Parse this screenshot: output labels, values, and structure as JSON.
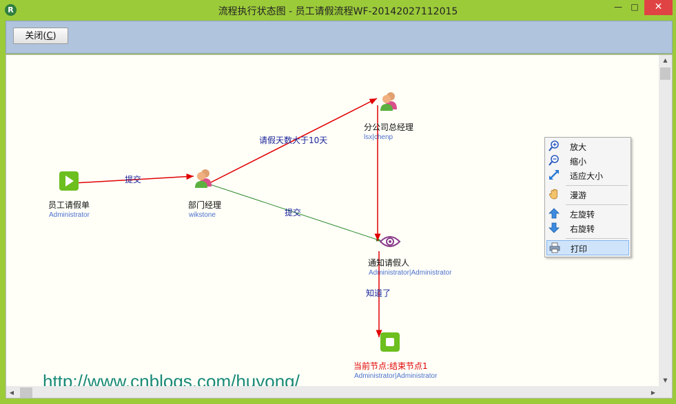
{
  "window": {
    "title": "流程执行状态图 - 员工请假流程WF-20142027112015",
    "app_icon": "R",
    "minimize_glyph": "—",
    "maximize_glyph": "□",
    "close_glyph": "✕"
  },
  "toolbar": {
    "close_label": "关闭(",
    "close_key": "C",
    "close_tail": ")"
  },
  "nodes": {
    "start": {
      "name": "员工请假单",
      "user": "Administrator"
    },
    "dept": {
      "name": "部门经理",
      "user": "wikstone"
    },
    "branch": {
      "name": "分公司总经理",
      "user": "lsx|chenp"
    },
    "notify": {
      "name": "通知请假人",
      "user": "Administrator|Administrator"
    },
    "end": {
      "name": "当前节点:结束节点1",
      "user": "Administrator|Administrator"
    }
  },
  "edges": {
    "submit1": "提交",
    "over10": "请假天数大于10天",
    "submit2": "提交",
    "acknowledged": "知道了"
  },
  "watermark": "http://www.cnblogs.com/huyong/",
  "context_menu": {
    "items": [
      {
        "label": "放大",
        "icon": "zoom-in-icon"
      },
      {
        "label": "缩小",
        "icon": "zoom-out-icon"
      },
      {
        "label": "适应大小",
        "icon": "fit-size-icon"
      },
      {
        "label": "漫游",
        "icon": "hand-icon"
      },
      {
        "label": "左旋转",
        "icon": "rotate-left-icon"
      },
      {
        "label": "右旋转",
        "icon": "rotate-right-icon"
      },
      {
        "label": "打印",
        "icon": "print-icon"
      }
    ]
  },
  "colors": {
    "window_frame": "#9ccb3a",
    "toolbar_bg": "#b0c4de",
    "canvas_bg": "#fffff8",
    "edge_red": "#e00000",
    "edge_green": "#2e8b2e",
    "edge_label": "#1a2399",
    "user_text": "#4c6fcc",
    "watermark": "#1a8a78"
  }
}
